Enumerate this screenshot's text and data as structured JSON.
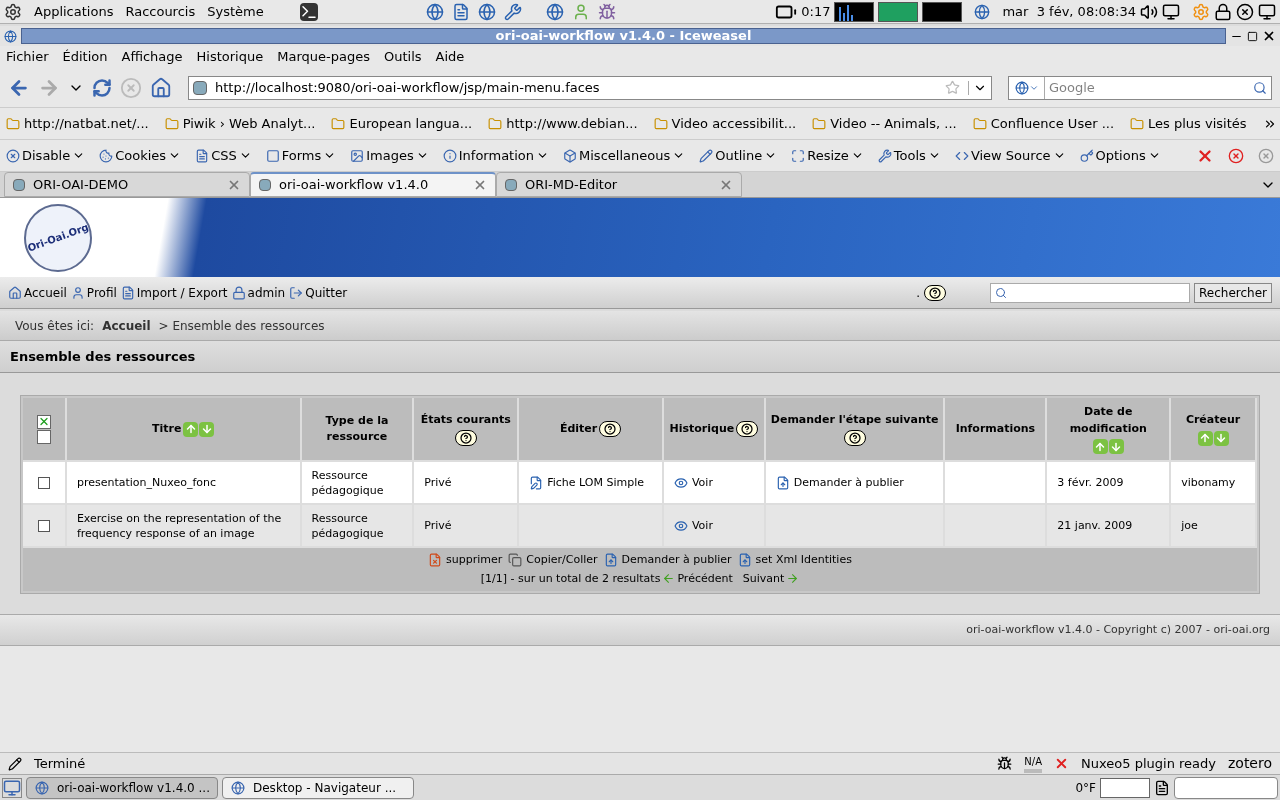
{
  "top_panel": {
    "menus": [
      "Applications",
      "Raccourcis",
      "Système"
    ],
    "battery_time": "0:17",
    "clock": "mar  3 fév, 08:08:34"
  },
  "window": {
    "title": "ori-oai-workflow v1.4.0 - Iceweasel"
  },
  "menu_bar": [
    "Fichier",
    "Édition",
    "Affichage",
    "Historique",
    "Marque-pages",
    "Outils",
    "Aide"
  ],
  "nav": {
    "url": "http://localhost:9080/ori-oai-workflow/jsp/main-menu.faces",
    "search_placeholder": "Google"
  },
  "bookmarks": [
    "http://natbat.net/...",
    "Piwik › Web Analyt...",
    "European langua...",
    "http://www.debian...",
    "Video accessibilit...",
    "Video -- Animals, ...",
    "Confluence User ...",
    "Les plus visités"
  ],
  "dev_toolbar": [
    "Disable",
    "Cookies",
    "CSS",
    "Forms",
    "Images",
    "Information",
    "Miscellaneous",
    "Outline",
    "Resize",
    "Tools",
    "View Source",
    "Options"
  ],
  "tabs": [
    {
      "label": "ORI-OAI-DEMO",
      "selected": false
    },
    {
      "label": "ori-oai-workflow v1.4.0",
      "selected": true
    },
    {
      "label": "ORI-MD-Editor",
      "selected": false
    }
  ],
  "app": {
    "logo": "Ori-Oai.Org",
    "toolbar": [
      "Accueil",
      "Profil",
      "Import / Export",
      "admin",
      "Quitter"
    ],
    "help_prefix": ".",
    "search_button": "Rechercher",
    "breadcrumb": {
      "label": "Vous êtes ici:",
      "current": "Accueil",
      "trail": "> Ensemble des ressources"
    },
    "heading": "Ensemble des ressources",
    "table": {
      "select_all": [
        {
          "checked": true
        },
        {
          "checked": false
        }
      ],
      "columns": [
        {
          "label": "Titre",
          "sortable": true,
          "help": false
        },
        {
          "label": "Type de la ressource",
          "sortable": false,
          "help": false
        },
        {
          "label": "États courants",
          "sortable": false,
          "help": true
        },
        {
          "label": "Éditer",
          "sortable": false,
          "help": true
        },
        {
          "label": "Historique",
          "sortable": false,
          "help": true
        },
        {
          "label": "Demander l'étape suivante",
          "sortable": false,
          "help": true
        },
        {
          "label": "Informations",
          "sortable": false,
          "help": false
        },
        {
          "label": "Date de modification",
          "sortable": true,
          "help": false
        },
        {
          "label": "Créateur",
          "sortable": true,
          "help": false
        }
      ],
      "rows": [
        {
          "checked": false,
          "cells": [
            {
              "text": "presentation_Nuxeo_fonc"
            },
            {
              "text": "Ressource pédagogique"
            },
            {
              "text": "Privé"
            },
            {
              "text": "Fiche LOM Simple",
              "kind": "edit"
            },
            {
              "text": "Voir",
              "kind": "view"
            },
            {
              "text": "Demander à publier",
              "kind": "publish"
            },
            {
              "text": ""
            },
            {
              "text": "3 févr. 2009"
            },
            {
              "text": "vibonamy"
            }
          ]
        },
        {
          "checked": false,
          "cells": [
            {
              "text": "Exercise on the representation of the frequency response of an image"
            },
            {
              "text": "Ressource pédagogique"
            },
            {
              "text": "Privé"
            },
            {
              "text": ""
            },
            {
              "text": "Voir",
              "kind": "view"
            },
            {
              "text": ""
            },
            {
              "text": ""
            },
            {
              "text": "21 janv. 2009"
            },
            {
              "text": "joe"
            }
          ]
        }
      ],
      "actions": [
        {
          "label": "supprimer",
          "kind": "delete"
        },
        {
          "label": "Copier/Coller",
          "kind": "copy"
        },
        {
          "label": "Demander à publier",
          "kind": "publish"
        },
        {
          "label": "set Xml Identities",
          "kind": "publish"
        }
      ],
      "pagination": {
        "summary": "[1/1] - sur un total de 2 resultats",
        "previous": "Précédent",
        "next": "Suivant"
      }
    },
    "footer": "ori-oai-workflow v1.4.0 - Copyright c) 2007 - ori-oai.org"
  },
  "status_bar": {
    "text": "Terminé",
    "meter": "N/A",
    "plugin": "Nuxeo5 plugin ready",
    "zotero": "zotero"
  },
  "taskbar": {
    "items": [
      {
        "label": "ori-oai-workflow v1.4.0 ...",
        "selected": true
      },
      {
        "label": "Desktop - Navigateur ...",
        "selected": false
      }
    ],
    "temperature": "0°F"
  }
}
